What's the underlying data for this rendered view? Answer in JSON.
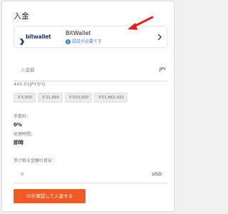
{
  "page": {
    "title": "入金"
  },
  "payment_method": {
    "logo_text": "bitwallet",
    "name": "BitWallet",
    "status": "認証が必要です",
    "icons": {
      "logo": "bitwallet-logo-icon",
      "status": "info-icon",
      "chevron": "chevron-right-icon",
      "annotation": "red-arrow-icon"
    }
  },
  "amount": {
    "placeholder": "入金額",
    "value": "",
    "currency": "JPY",
    "minimum_text": "445.01JPYから"
  },
  "presets": [
    "￥5,500",
    "￥31,000",
    "￥510,000",
    "￥51,662,421"
  ],
  "fee": {
    "label": "手数料：",
    "value": "0%"
  },
  "processing_time": {
    "label": "処理時間：",
    "value": "即時"
  },
  "receive": {
    "label": "受け取る金額の目安：",
    "value": "0",
    "currency": "USD"
  },
  "submit": {
    "label": "IDを確認して入金する"
  },
  "colors": {
    "accent": "#f15a24",
    "status_blue": "#3a7bd5",
    "annotation_red": "#e3201c",
    "logo_blue": "#1f3b6d"
  }
}
